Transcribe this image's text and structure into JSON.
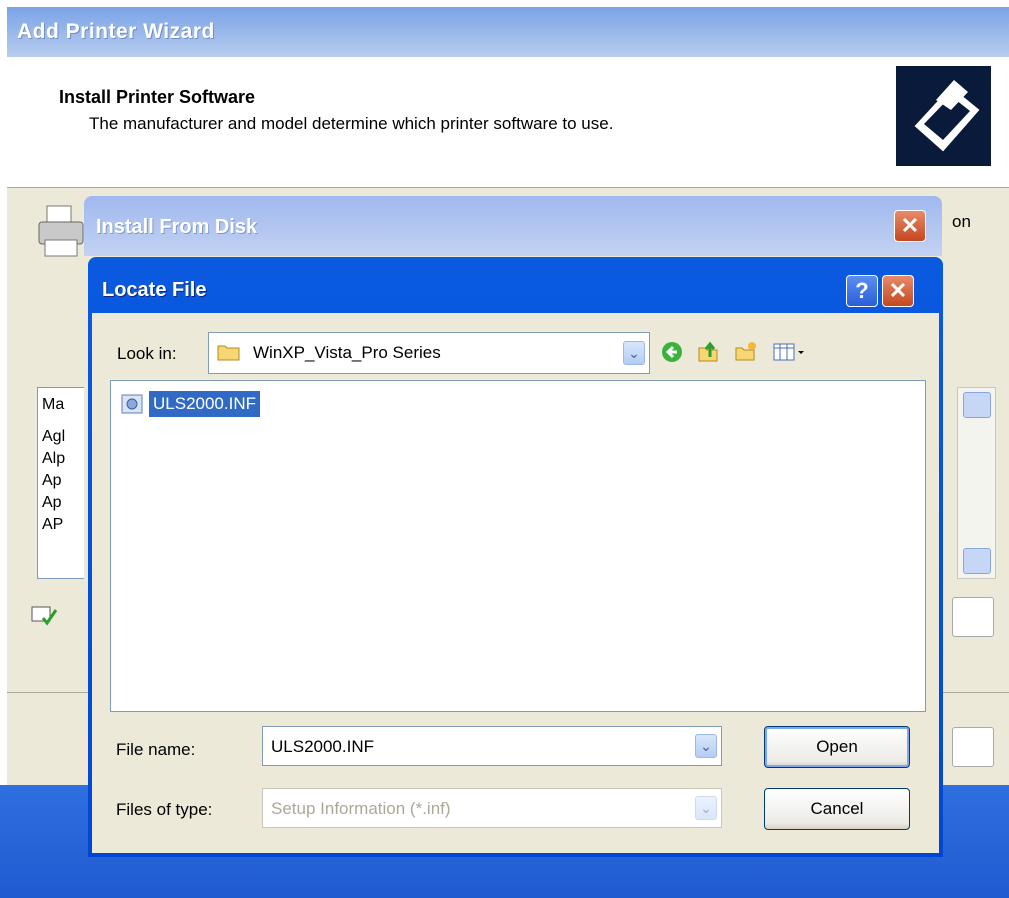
{
  "wizard": {
    "title": "Add Printer Wizard",
    "header_title": "Install Printer Software",
    "header_subtitle": "The manufacturer and model determine which printer software to use.",
    "partial_text_right": "on",
    "list_items": [
      "Ma",
      "Agl",
      "Alp",
      "Ap",
      "Ap",
      "AP"
    ]
  },
  "install_from_disk": {
    "title": "Install From Disk"
  },
  "locate_file": {
    "title": "Locate File",
    "look_in_label": "Look in:",
    "look_in_value": "WinXP_Vista_Pro Series",
    "files": [
      "ULS2000.INF"
    ],
    "file_name_label": "File name:",
    "file_name_value": "ULS2000.INF",
    "files_of_type_label": "Files of type:",
    "files_of_type_value": "Setup Information (*.inf)",
    "open_label": "Open",
    "cancel_label": "Cancel",
    "help_glyph": "?",
    "close_glyph": "✕"
  },
  "icons": [
    "printer-icon",
    "folder-icon",
    "back-icon",
    "up-folder-icon",
    "new-folder-icon",
    "view-menu-icon",
    "inf-file-icon",
    "certificate-icon"
  ]
}
